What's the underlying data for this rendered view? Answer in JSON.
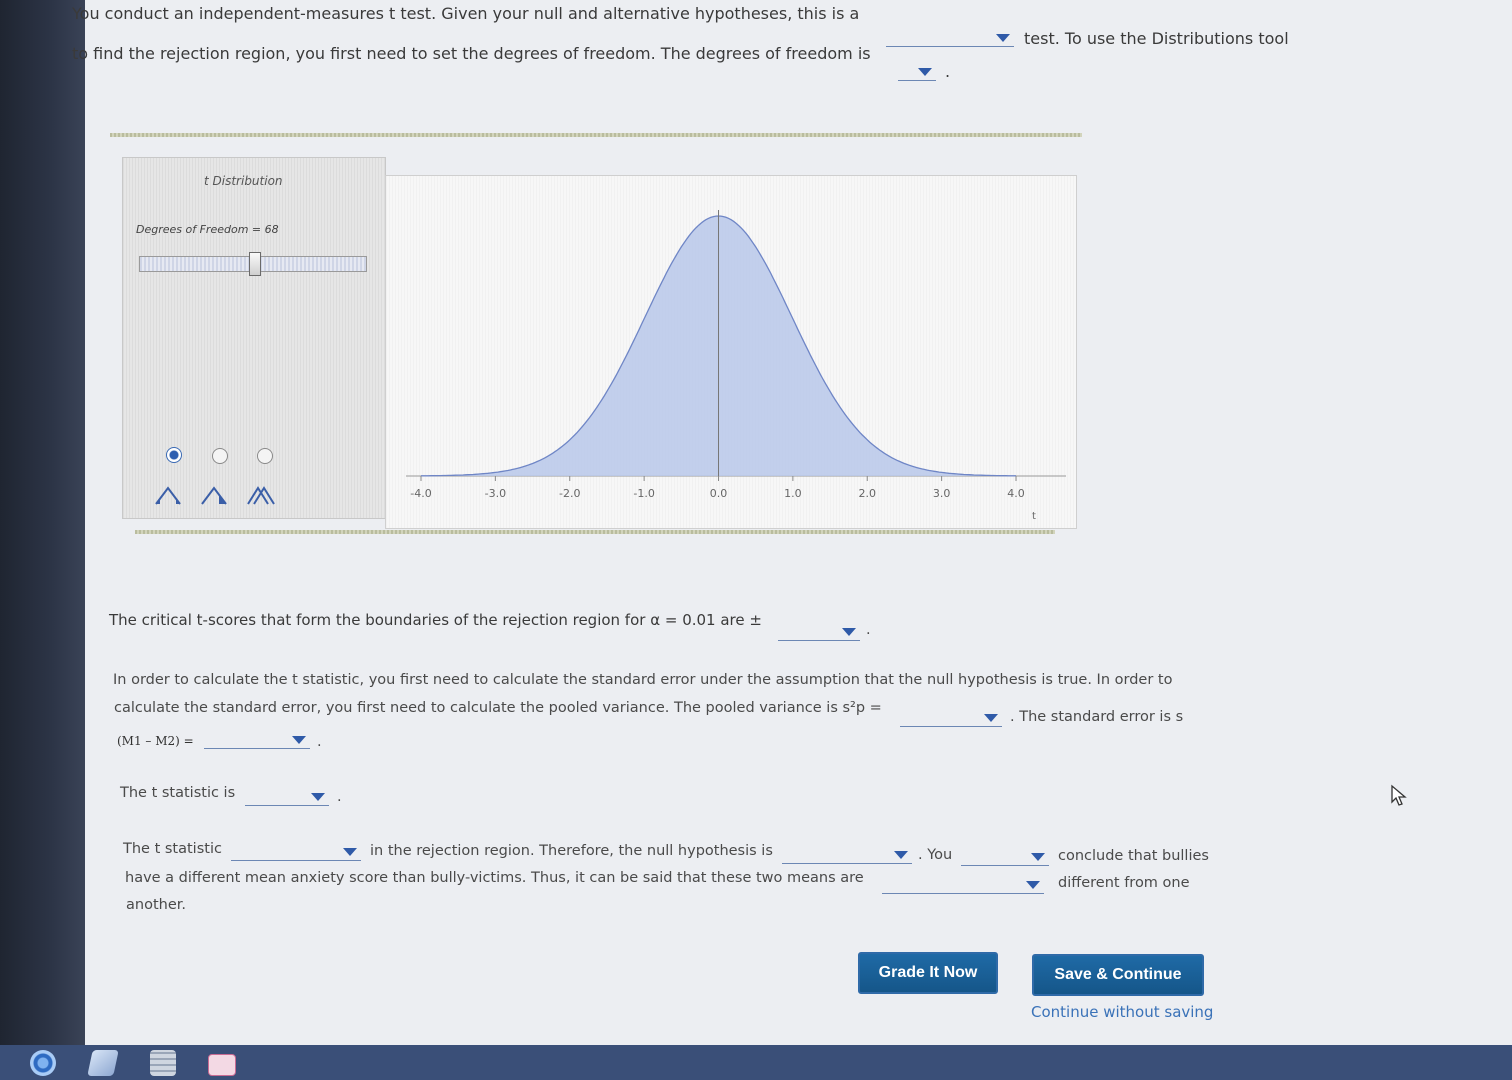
{
  "question": {
    "line1": "You conduct an independent-measures t test. Given your null and alternative hypotheses, this is a",
    "line1_after": "test. To use the Distributions tool",
    "line2": "to find the rejection region, you first need to set the degrees of freedom. The degrees of freedom is",
    "line2_end": ".",
    "critical": "The critical t-scores that form the boundaries of the rejection region for α = 0.01 are ±",
    "critical_end": ".",
    "se_line1": "In order to calculate the t statistic, you first need to calculate the standard error under the assumption that the null hypothesis is true. In order to",
    "se_line2": "calculate the standard error, you first need to calculate the pooled variance. The pooled variance is s²p =",
    "se_line2_after": ". The standard error is s",
    "se_line3": "(M1 – M2) =",
    "se_line3_end": ".",
    "tstat": "The t statistic is",
    "tstat_end": ".",
    "concl_a": "The t statistic",
    "concl_b": "in the rejection region. Therefore, the null hypothesis is",
    "concl_c": ". You",
    "concl_d": "conclude that bullies",
    "concl_e": "have a different mean anxiety score than bully-victims. Thus, it can be said that these two means are",
    "concl_f": "different from one",
    "concl_g": "another."
  },
  "tool": {
    "title": "t Distribution",
    "df_label": "Degrees of Freedom = 68",
    "df_value": 68,
    "tail_modes": [
      "two-tailed",
      "one-tailed-left",
      "one-tailed-right"
    ],
    "selected_mode": 0
  },
  "chart_data": {
    "type": "area",
    "distribution": "t",
    "df": 68,
    "xlabel": "t",
    "xlim": [
      -4.0,
      4.0
    ],
    "xticks": [
      "-4.0",
      "-3.0",
      "-2.0",
      "-1.0",
      "0.0",
      "1.0",
      "2.0",
      "3.0",
      "4.0"
    ],
    "fill_color": "#b9c8ea",
    "line_color": "#6f86c6"
  },
  "buttons": {
    "grade": "Grade It Now",
    "save": "Save & Continue",
    "continue": "Continue without saving"
  }
}
